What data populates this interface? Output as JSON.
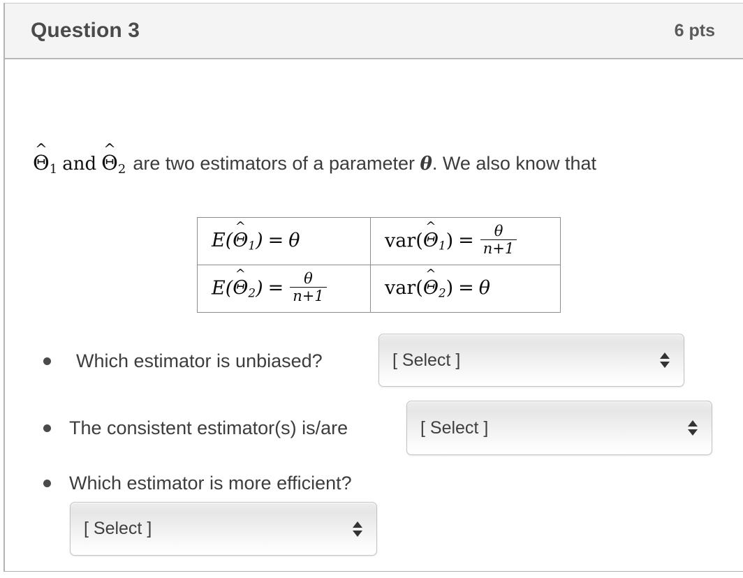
{
  "header": {
    "title": "Question 3",
    "points": "6 pts"
  },
  "intro": {
    "math_theta1": "Θ",
    "math_sub1": "1",
    "and_word": "and",
    "math_theta2": "Θ",
    "math_sub2": "2",
    "hat": "^",
    "text": "are two estimators of a parameter",
    "theta_symbol": "θ",
    "text_tail": ". We also know that"
  },
  "math_table": {
    "rows": [
      {
        "left": {
          "func": "E",
          "arg_symbol": "Θ",
          "arg_sub": "1",
          "equals": "=",
          "rhs_kind": "symbol",
          "rhs": "θ"
        },
        "right": {
          "func": "var",
          "arg_symbol": "Θ",
          "arg_sub": "1",
          "equals": "=",
          "rhs_kind": "fraction",
          "rhs_num": "θ",
          "rhs_den": "n+1"
        }
      },
      {
        "left": {
          "func": "E",
          "arg_symbol": "Θ",
          "arg_sub": "2",
          "equals": "=",
          "rhs_kind": "fraction",
          "rhs_num": "θ",
          "rhs_den": "n+1"
        },
        "right": {
          "func": "var",
          "arg_symbol": "Θ",
          "arg_sub": "2",
          "equals": "=",
          "rhs_kind": "symbol",
          "rhs": "θ"
        }
      }
    ]
  },
  "questions": [
    {
      "label": "Which estimator is unbiased?",
      "select_value": "[ Select ]"
    },
    {
      "label": "The consistent estimator(s) is/are",
      "select_value": "[ Select ]"
    },
    {
      "label": "Which estimator is more efficient?",
      "select_value": "[ Select ]"
    }
  ],
  "colors": {
    "header_bg": "#f4f4f4",
    "header_text": "#4a4a4a",
    "body_text": "#3d3d3d",
    "border": "#b6b6b6",
    "table_border": "#8c8c8c",
    "select_border": "#c3c3c3"
  }
}
